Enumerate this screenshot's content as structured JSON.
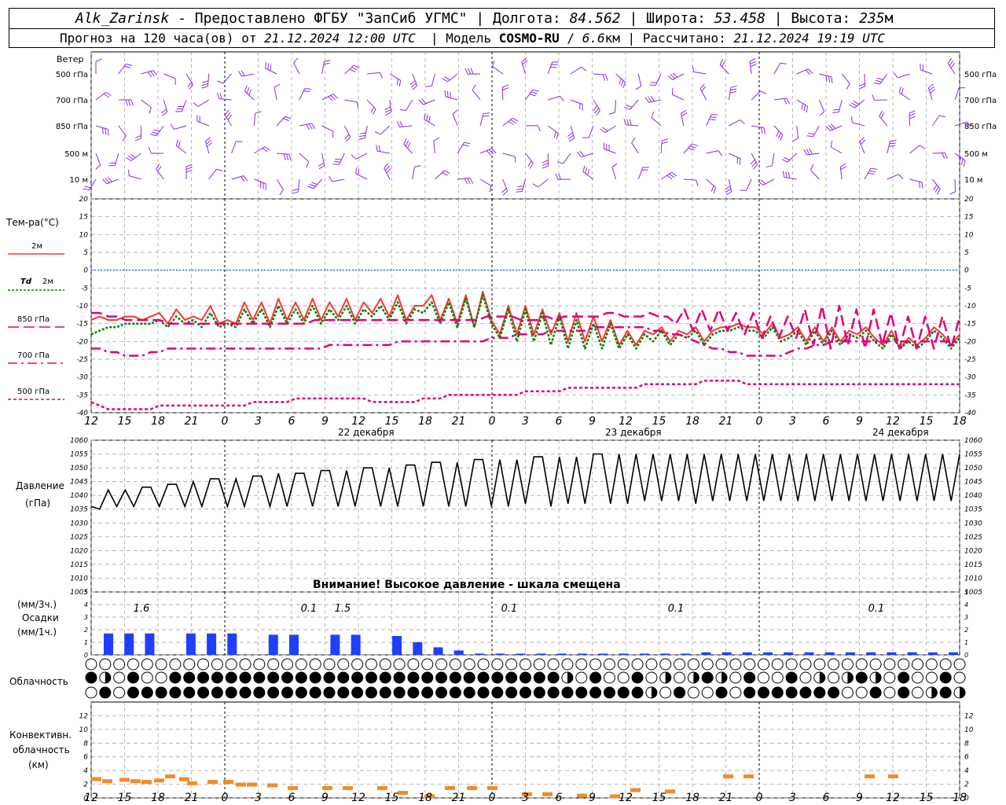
{
  "header": {
    "station": "Alk_Zarinsk",
    "provider": "- Предоставлено ФГБУ \"ЗапСиб УГМС\"",
    "lon_label": "Долгота:",
    "lon": "84.562",
    "lat_label": "Широта:",
    "lat": "53.458",
    "alt_label": "Высота:",
    "alt": "235",
    "alt_unit": "м",
    "forecast_prefix": "Прогноз на 120 часа(ов) от",
    "forecast_start": "21.12.2024 12:00 UTC",
    "model_label": "Модель",
    "model": "COSMO-RU",
    "model_res": "6.6",
    "model_res_unit": "км",
    "calc_label": "Рассчитано:",
    "calc_time": "21.12.2024 19:19 UTC"
  },
  "labels": {
    "wind_title": "Ветер",
    "wind_levels": [
      "500 гПа",
      "700 гПа",
      "850 гПа",
      "500 м",
      "10 м"
    ],
    "temp_title": "Тем-ра(°C)",
    "t2m": "2м",
    "td_sym": "Td",
    "td2m": "2м",
    "t850": "850 гПа",
    "t700": "700 гПа",
    "t500": "500 гПа",
    "pressure_title": "Давление",
    "pressure_unit": "(гПа)",
    "pressure_warning": "Внимание! Высокое давление - шкала смещена",
    "precip_unit3": "(мм/3ч.)",
    "precip_title": "Осадки",
    "precip_unit1": "(мм/1ч.)",
    "cloud_title": "Облачность",
    "conv_title1": "Конвективн.",
    "conv_title2": "облачность",
    "conv_unit": "(км)",
    "dates": [
      "22 декабря",
      "23 декабря",
      "24 декабря"
    ]
  },
  "colors": {
    "t2m": "#ff3333",
    "td2m": "#008000",
    "t850": "#e0007a",
    "t700": "#e0007a",
    "t500": "#e0007a",
    "wind": "#8a2be2",
    "pressure": "#000000",
    "precip": "#1f3fff",
    "conv": "#f28c28",
    "zero_line": "#0033cc",
    "grid": "#999999"
  },
  "chart_data": {
    "type": "line",
    "x_hours": [
      "12",
      "15",
      "18",
      "21",
      "0",
      "3",
      "6",
      "9",
      "12",
      "15",
      "18",
      "21",
      "0",
      "3",
      "6",
      "9",
      "12",
      "15",
      "18",
      "21",
      "0",
      "3",
      "6",
      "9",
      "12",
      "15",
      "18"
    ],
    "temperature": {
      "ylim": [
        -40,
        20
      ],
      "yticks": [
        20,
        15,
        10,
        5,
        0,
        -5,
        -10,
        -15,
        -20,
        -25,
        -30,
        -35,
        -40
      ],
      "series": [
        {
          "name": "2м",
          "values": [
            -14,
            -13,
            -14,
            -14,
            -13,
            -13,
            -14,
            -13,
            -12,
            -15,
            -11,
            -14,
            -13,
            -14,
            -10,
            -15,
            -14,
            -15,
            -9,
            -14,
            -9,
            -15,
            -8,
            -14,
            -9,
            -14,
            -8,
            -14,
            -9,
            -13,
            -8,
            -14,
            -9,
            -12,
            -8,
            -13,
            -7,
            -14,
            -10,
            -10,
            -7,
            -14,
            -8,
            -15,
            -7,
            -16,
            -6,
            -14,
            -18,
            -10,
            -18,
            -10,
            -18,
            -11,
            -18,
            -12,
            -20,
            -12,
            -20,
            -13,
            -20,
            -14,
            -21,
            -17,
            -21,
            -17,
            -18,
            -16,
            -20,
            -17,
            -18,
            -16,
            -20,
            -17,
            -16,
            -16,
            -15,
            -16,
            -16,
            -18,
            -15,
            -19,
            -18,
            -16,
            -20,
            -16,
            -20,
            -16,
            -20,
            -17,
            -18,
            -16,
            -19,
            -21,
            -17,
            -22,
            -19,
            -21,
            -19,
            -16,
            -18,
            -21,
            -18
          ]
        },
        {
          "name": "Td 2м",
          "values": [
            -18,
            -17,
            -16,
            -16,
            -15,
            -15,
            -15,
            -15,
            -14,
            -16,
            -13,
            -15,
            -14,
            -16,
            -12,
            -16,
            -15,
            -16,
            -11,
            -15,
            -11,
            -16,
            -10,
            -15,
            -11,
            -15,
            -10,
            -15,
            -11,
            -14,
            -10,
            -15,
            -11,
            -13,
            -10,
            -14,
            -9,
            -15,
            -11,
            -12,
            -9,
            -15,
            -9,
            -16,
            -8,
            -16,
            -7,
            -15,
            -19,
            -11,
            -20,
            -11,
            -20,
            -12,
            -21,
            -13,
            -22,
            -14,
            -22,
            -15,
            -22,
            -15,
            -22,
            -18,
            -22,
            -18,
            -20,
            -17,
            -21,
            -18,
            -19,
            -17,
            -21,
            -18,
            -17,
            -17,
            -16,
            -17,
            -17,
            -19,
            -16,
            -20,
            -19,
            -17,
            -21,
            -17,
            -21,
            -17,
            -21,
            -18,
            -19,
            -17,
            -20,
            -22,
            -18,
            -22,
            -20,
            -22,
            -20,
            -17,
            -19,
            -22,
            -19
          ]
        },
        {
          "name": "850 гПа",
          "values": [
            -12,
            -12,
            -13,
            -13,
            -14,
            -14,
            -14,
            -14,
            -14,
            -15,
            -15,
            -15,
            -15,
            -15,
            -15,
            -15,
            -15,
            -15,
            -15,
            -15,
            -15,
            -15,
            -15,
            -15,
            -15,
            -15,
            -14,
            -14,
            -14,
            -14,
            -14,
            -14,
            -14,
            -14,
            -14,
            -14,
            -14,
            -14,
            -14,
            -14,
            -14,
            -14,
            -14,
            -14,
            -14,
            -14,
            -13,
            -13,
            -13,
            -13,
            -14,
            -14,
            -14,
            -13,
            -14,
            -13,
            -13,
            -13,
            -13,
            -13,
            -12,
            -12,
            -13,
            -13,
            -13,
            -12,
            -13,
            -13,
            -15,
            -11,
            -17,
            -11,
            -17,
            -11,
            -17,
            -12,
            -18,
            -12,
            -19,
            -13,
            -19,
            -13,
            -19,
            -11,
            -21,
            -10,
            -22,
            -10,
            -21,
            -11,
            -22,
            -11,
            -21,
            -12,
            -22,
            -13,
            -22,
            -13,
            -22,
            -13,
            -22,
            -13
          ]
        },
        {
          "name": "700 гПа",
          "values": [
            -22,
            -22,
            -23,
            -23,
            -24,
            -24,
            -24,
            -23,
            -23,
            -22,
            -22,
            -22,
            -22,
            -22,
            -22,
            -22,
            -22,
            -22,
            -22,
            -22,
            -22,
            -22,
            -22,
            -22,
            -22,
            -22,
            -22,
            -22,
            -21,
            -21,
            -21,
            -21,
            -21,
            -21,
            -21,
            -21,
            -20,
            -20,
            -20,
            -20,
            -20,
            -20,
            -20,
            -20,
            -20,
            -20,
            -20,
            -19,
            -19,
            -19,
            -18,
            -18,
            -18,
            -18,
            -17,
            -17,
            -17,
            -17,
            -17,
            -16,
            -16,
            -16,
            -16,
            -16,
            -16,
            -16,
            -17,
            -17,
            -18,
            -18,
            -19,
            -20,
            -21,
            -22,
            -22,
            -23,
            -23,
            -24,
            -24,
            -24,
            -24,
            -24,
            -23,
            -22,
            -22,
            -21,
            -21,
            -20,
            -20,
            -20,
            -20,
            -20,
            -20,
            -20,
            -20,
            -20,
            -20,
            -20,
            -20,
            -20,
            -20,
            -20,
            -20
          ]
        },
        {
          "name": "500 гПа",
          "values": [
            -37,
            -38,
            -39,
            -39,
            -39,
            -39,
            -39,
            -39,
            -38,
            -38,
            -38,
            -38,
            -38,
            -38,
            -38,
            -38,
            -38,
            -38,
            -38,
            -37,
            -37,
            -37,
            -37,
            -37,
            -36,
            -36,
            -36,
            -36,
            -36,
            -36,
            -36,
            -36,
            -36,
            -37,
            -37,
            -37,
            -37,
            -37,
            -37,
            -36,
            -36,
            -36,
            -35,
            -35,
            -35,
            -35,
            -35,
            -35,
            -35,
            -35,
            -35,
            -34,
            -34,
            -34,
            -34,
            -34,
            -33,
            -33,
            -33,
            -33,
            -33,
            -33,
            -33,
            -33,
            -33,
            -32,
            -32,
            -32,
            -32,
            -32,
            -32,
            -32,
            -31,
            -31,
            -31,
            -31,
            -31,
            -32,
            -32,
            -32,
            -32,
            -32,
            -32,
            -32,
            -32,
            -32,
            -32,
            -32,
            -32,
            -32,
            -32,
            -32,
            -32,
            -32,
            -32,
            -32,
            -32,
            -32,
            -32,
            -32,
            -32,
            -32,
            -32
          ]
        }
      ]
    },
    "pressure": {
      "ylim": [
        1005,
        1060
      ],
      "yticks": [
        1060,
        1055,
        1050,
        1045,
        1040,
        1035,
        1030,
        1025,
        1020,
        1015,
        1010,
        1005
      ],
      "values": [
        1036,
        1035,
        1042,
        1036,
        1042,
        1036,
        1043,
        1043,
        1036,
        1044,
        1044,
        1036,
        1045,
        1036,
        1046,
        1046,
        1036,
        1046,
        1036,
        1047,
        1047,
        1036,
        1048,
        1036,
        1048,
        1048,
        1036,
        1049,
        1049,
        1036,
        1049,
        1036,
        1050,
        1050,
        1036,
        1050,
        1036,
        1051,
        1051,
        1036,
        1052,
        1052,
        1036,
        1052,
        1036,
        1053,
        1053,
        1036,
        1053,
        1036,
        1053,
        1037,
        1054,
        1054,
        1036,
        1054,
        1037,
        1054,
        1037,
        1055,
        1055,
        1037,
        1055,
        1037,
        1055,
        1038,
        1055,
        1038,
        1055,
        1038,
        1055,
        1037,
        1055,
        1038,
        1055,
        1038,
        1055,
        1038,
        1055,
        1038,
        1055,
        1038,
        1055,
        1038,
        1055,
        1038,
        1055,
        1038,
        1055,
        1038,
        1055,
        1038,
        1055,
        1038,
        1055,
        1038,
        1055,
        1038,
        1055,
        1038,
        1055,
        1038,
        1055
      ]
    },
    "precipitation": {
      "ylim": [
        0,
        5
      ],
      "yticks": [
        5,
        4,
        3,
        2,
        1,
        0
      ],
      "hourly_mm": [
        1.7,
        1.7,
        1.7,
        0,
        1.7,
        1.7,
        1.7,
        0,
        1.6,
        1.6,
        0,
        1.6,
        1.6,
        0,
        1.5,
        1.0,
        0.6,
        0.35,
        0.1,
        0.1,
        0.1,
        0.1,
        0.1,
        0.1,
        0.1,
        0.1,
        0.1,
        0.1,
        0.1,
        0.2,
        0.2,
        0.2,
        0.2,
        0.2,
        0.2,
        0.2,
        0.2,
        0.2,
        0.2,
        0.2,
        0.2,
        0.2
      ],
      "sum3h": [
        "1.6",
        "0.1",
        "1.5",
        "0.1",
        "0.1",
        "0.1"
      ]
    },
    "cloud_cover_rows": 3,
    "convective_cloud": {
      "ylim": [
        0,
        14
      ],
      "yticks": [
        12,
        10,
        8,
        6,
        4,
        2,
        0
      ],
      "top_km": [
        2.8,
        2.5,
        2.7,
        2.5,
        2.4,
        2.6,
        3.2,
        2.8,
        2.2,
        2.4,
        2.4,
        2.0,
        2.0,
        1.9,
        1.5,
        1.5,
        1.5,
        1.5,
        0.8,
        0.3,
        1.5,
        1.5,
        1.5,
        0.6,
        0.6,
        0.4,
        0.3,
        1.2,
        1.0,
        3.2,
        3.2,
        3.2,
        3.2
      ]
    }
  }
}
